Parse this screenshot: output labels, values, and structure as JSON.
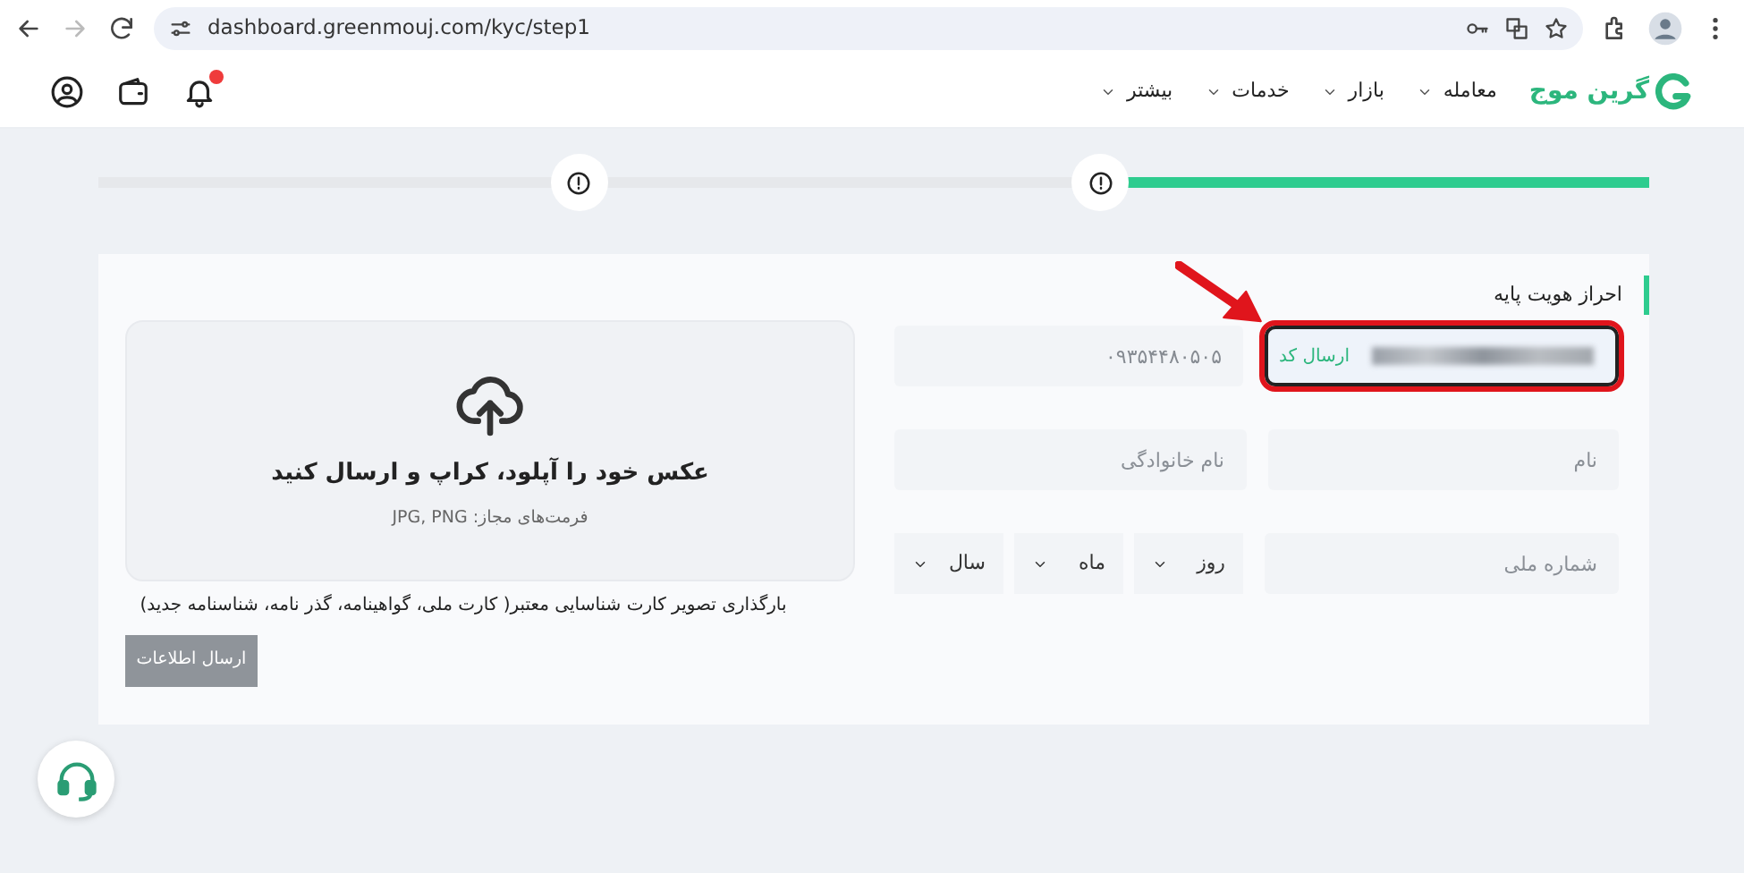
{
  "browser": {
    "url": "dashboard.greenmouj.com/kyc/step1",
    "forward_disabled": true
  },
  "header": {
    "logo": "گرین موج",
    "menu": [
      {
        "label": "معامله"
      },
      {
        "label": "بازار"
      },
      {
        "label": "خدمات"
      },
      {
        "label": "بیشتر"
      }
    ],
    "notifications_unread": true
  },
  "stepper": {
    "level": 0.35
  },
  "form": {
    "title": "احراز هویت پایه",
    "email": {
      "send_code": "ارسال کد",
      "highlighted": true
    },
    "mobile": {
      "value": "۰۹۳۵۴۴۸۰۵۰۵",
      "disabled": true
    },
    "first_name": {
      "placeholder": "نام"
    },
    "last_name": {
      "placeholder": "نام خانوادگی"
    },
    "national_id": {
      "placeholder": "شماره ملی"
    },
    "birth_date": [
      {
        "label": "روز"
      },
      {
        "label": "ماه"
      },
      {
        "label": "سال"
      }
    ]
  },
  "upload": {
    "title": "عکس خود را آپلود، کراپ و ارسال کنید",
    "formats": "فرمت‌های مجاز: JPG, PNG",
    "note": "بارگذاری تصویر کارت شناسایی معتبر( کارت ملی، گواهینامه، گذر نامه، شناسنامه جدید)"
  },
  "submit": {
    "label": "ارسال اطلاعات",
    "disabled": true
  }
}
